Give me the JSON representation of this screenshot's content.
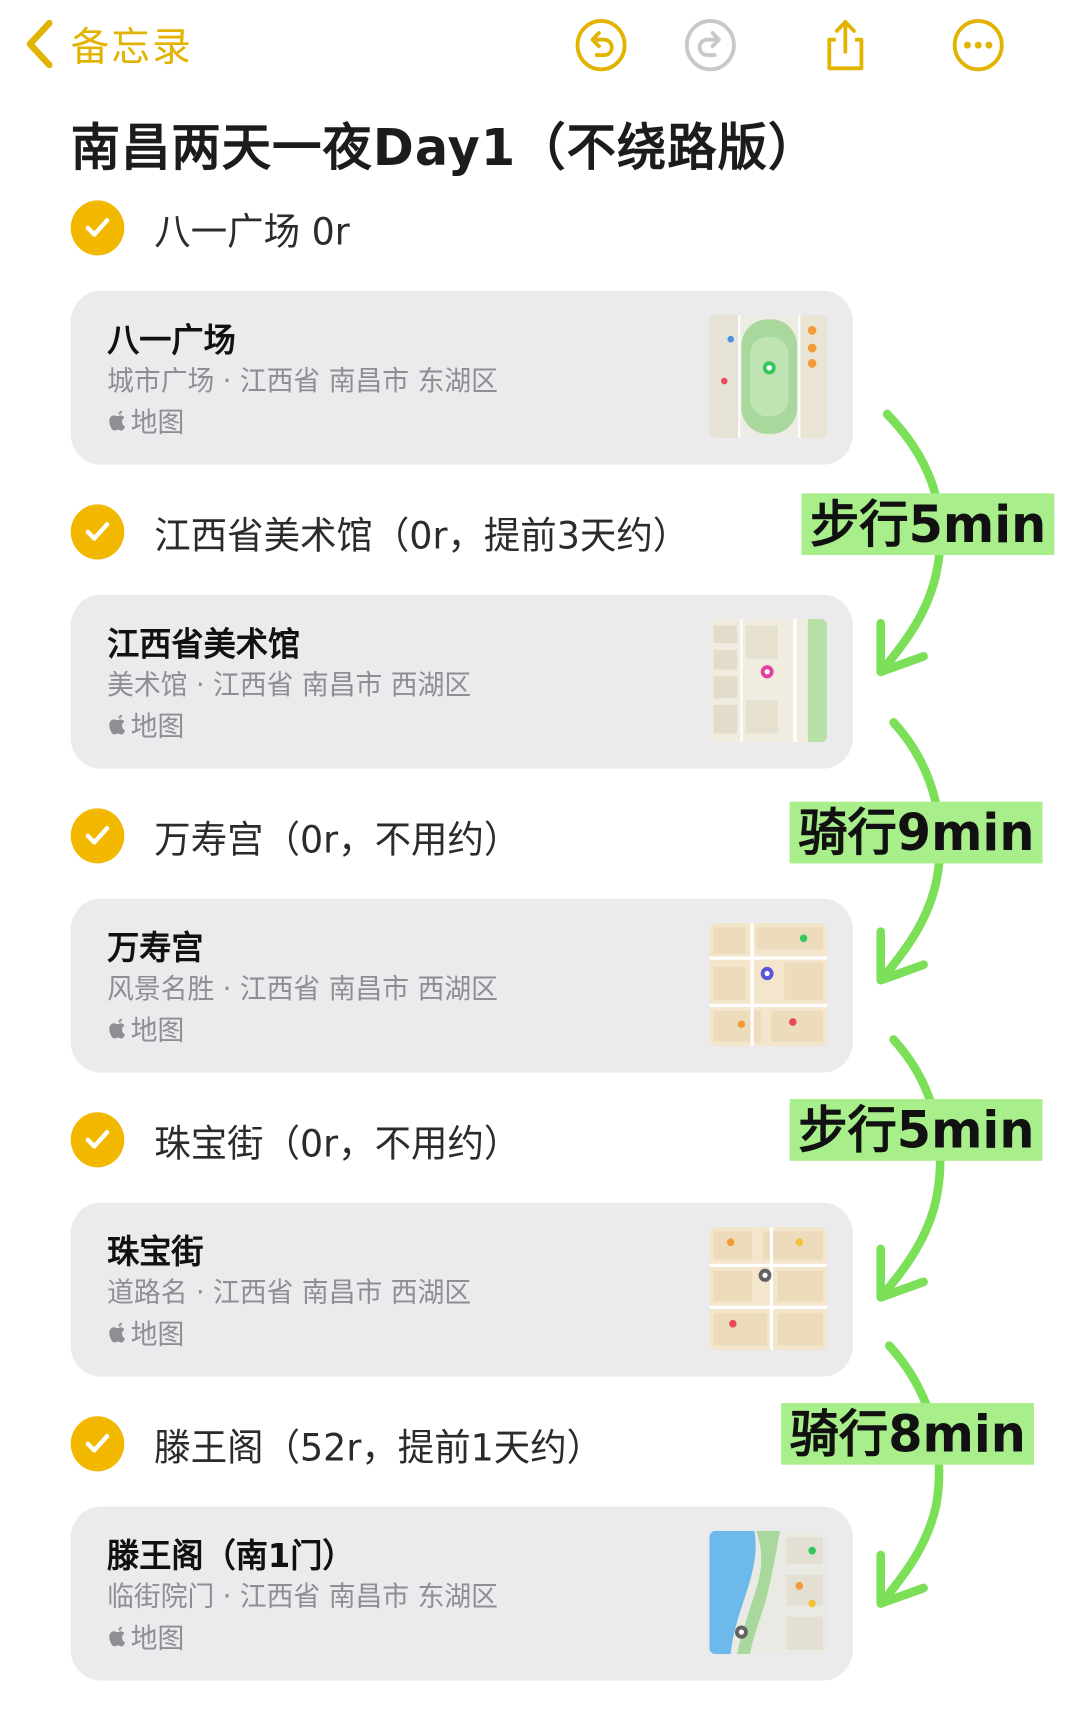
{
  "header": {
    "back_label": "备忘录",
    "buttons": [
      "undo-icon",
      "redo-icon",
      "share-icon",
      "more-icon"
    ],
    "accent_color": "#f2b800"
  },
  "note": {
    "title": "南昌两天一夜Day1（不绕路版）"
  },
  "main": {
    "items": [
      {
        "checked": true,
        "text": "八一广场 0r",
        "card": {
          "name": "八一广场",
          "subtitle": "城市广场 · 江西省 南昌市 东湖区",
          "source": "地图"
        }
      },
      {
        "checked": true,
        "text": "江西省美术馆（0r，提前3天约）",
        "card": {
          "name": "江西省美术馆",
          "subtitle": "美术馆 · 江西省 南昌市 西湖区",
          "source": "地图"
        }
      },
      {
        "checked": true,
        "text": "万寿宫（0r，不用约）",
        "card": {
          "name": "万寿宫",
          "subtitle": "风景名胜 · 江西省 南昌市 西湖区",
          "source": "地图"
        }
      },
      {
        "checked": true,
        "text": "珠宝街（0r，不用约）",
        "card": {
          "name": "珠宝街",
          "subtitle": "道路名 · 江西省 南昌市 西湖区",
          "source": "地图"
        }
      },
      {
        "checked": true,
        "text": "滕王阁（52r，提前1天约）",
        "card": {
          "name": "滕王阁（南1门）",
          "subtitle": "临街院门 · 江西省 南昌市 东湖区",
          "source": "地图"
        }
      }
    ]
  },
  "routes": [
    {
      "label": "步行5min"
    },
    {
      "label": "骑行9min"
    },
    {
      "label": "步行5min"
    },
    {
      "label": "骑行8min"
    }
  ],
  "colors": {
    "route_label_bg": "#a8ee8a",
    "route_arrow": "#7be058",
    "card_bg": "#ebebed"
  }
}
